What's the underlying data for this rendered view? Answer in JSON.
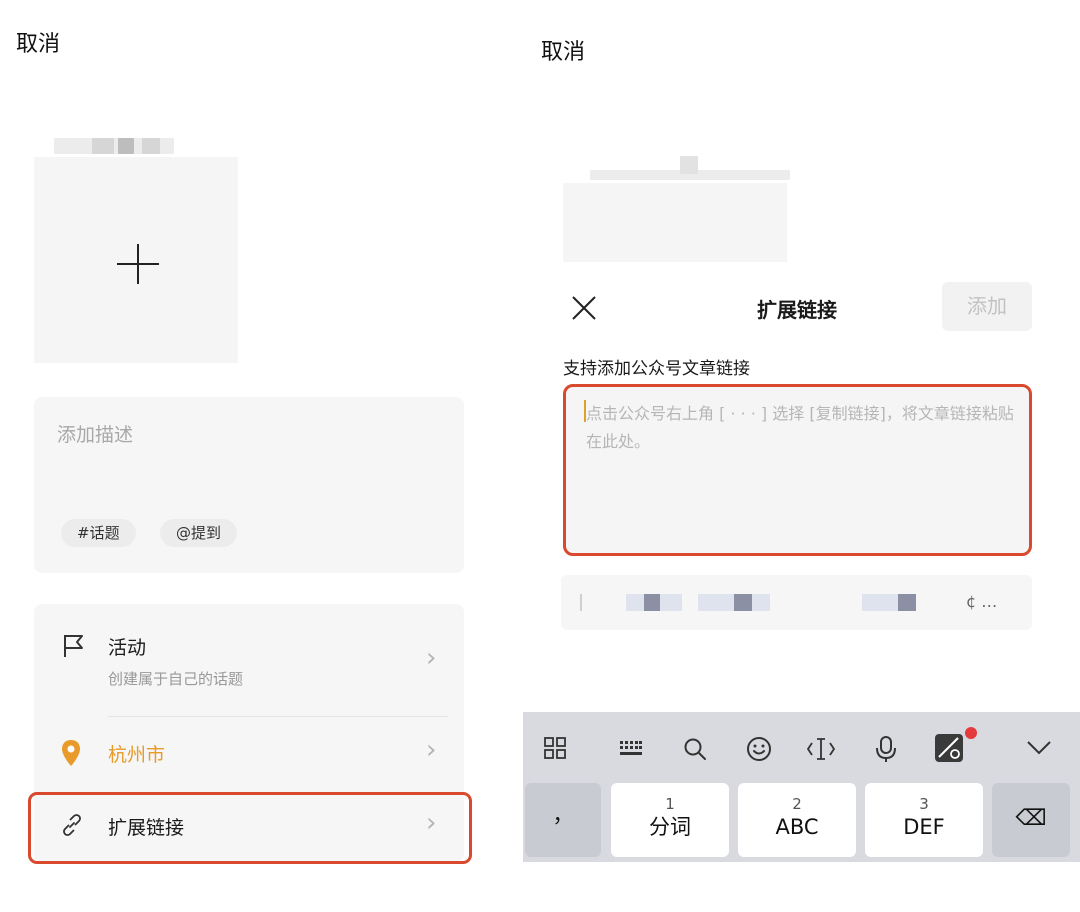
{
  "left": {
    "cancel": "取消",
    "description_placeholder": "添加描述",
    "chips": [
      "#话题",
      "@提到"
    ],
    "rows": {
      "activity": {
        "title": "活动",
        "subtitle": "创建属于自己的话题",
        "icon": "flag-icon"
      },
      "location": {
        "title": "杭州市",
        "icon": "location-pin-icon"
      },
      "extend_link": {
        "title": "扩展链接",
        "icon": "link-icon"
      }
    },
    "chevron": "›",
    "plus_icon": "plus-icon"
  },
  "right": {
    "cancel": "取消",
    "sheet": {
      "close_icon": "×",
      "title": "扩展链接",
      "add_button": "添加",
      "subtitle": "支持添加公众号文章链接",
      "placeholder": "点击公众号右上角 [ · · · ] 选择 [复制链接]，将文章链接粘贴在此处。",
      "clipboard_suffix": "¢ …"
    },
    "keyboard": {
      "toolbar_icons": [
        "grid-icon",
        "keyboard-icon",
        "search-icon",
        "emoji-icon",
        "cursor-icon",
        "microphone-icon",
        "sticker-icon",
        "chevron-down-icon"
      ],
      "keys": [
        {
          "num": "",
          "main": "，"
        },
        {
          "num": "1",
          "main": "分词"
        },
        {
          "num": "2",
          "main": "ABC"
        },
        {
          "num": "3",
          "main": "DEF"
        }
      ],
      "backspace_icon": "⌫"
    }
  },
  "colors": {
    "highlight_border": "#d8492e",
    "location_orange": "#e89a2a",
    "notification_dot": "#e33b3b"
  }
}
